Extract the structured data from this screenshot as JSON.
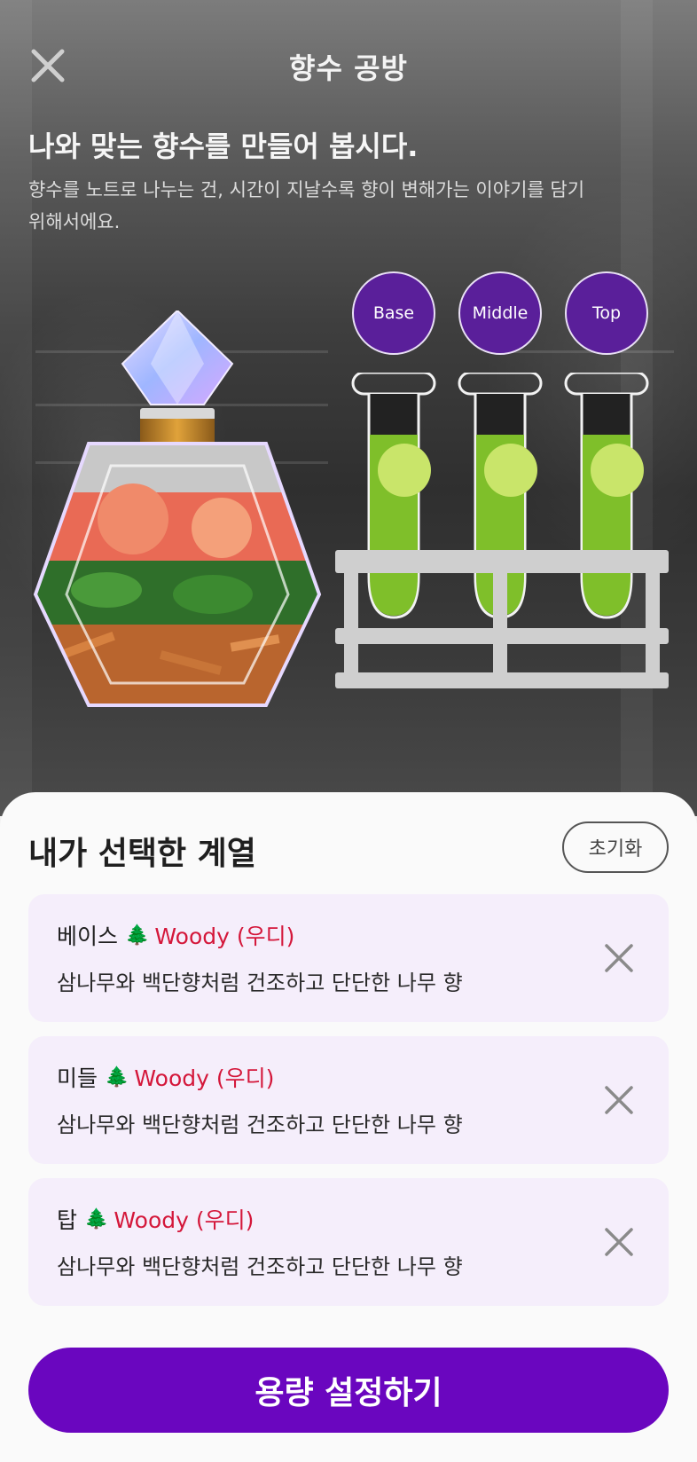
{
  "header": {
    "title": "향수 공방",
    "close_icon": "close-icon"
  },
  "hero": {
    "heading": "나와 맞는 향수를 만들어 봅시다.",
    "description": "향수를 노트로 나누는 건, 시간이 지날수록 향이 변해가는 이야기를 담기 위해서에요."
  },
  "notes": {
    "base": "Base",
    "middle": "Middle",
    "top": "Top"
  },
  "sheet": {
    "title": "내가 선택한 계열",
    "reset_label": "초기화",
    "cards": [
      {
        "position": "베이스",
        "family": "Woody (우디)",
        "icon": "tree-icon",
        "emoji": "🌲",
        "description": "삼나무와 백단향처럼 건조하고 단단한 나무 향"
      },
      {
        "position": "미들",
        "family": "Woody (우디)",
        "icon": "tree-icon",
        "emoji": "🌲",
        "description": "삼나무와 백단향처럼 건조하고 단단한 나무 향"
      },
      {
        "position": "탑",
        "family": "Woody (우디)",
        "icon": "tree-icon",
        "emoji": "🌲",
        "description": "삼나무와 백단향처럼 건조하고 단단한 나무 향"
      }
    ],
    "primary_label": "용량 설정하기"
  },
  "colors": {
    "accent": "#6a06bf",
    "note_circle": "#5a1f9a",
    "family_text": "#d4173a",
    "card_bg": "#f5eefb"
  }
}
